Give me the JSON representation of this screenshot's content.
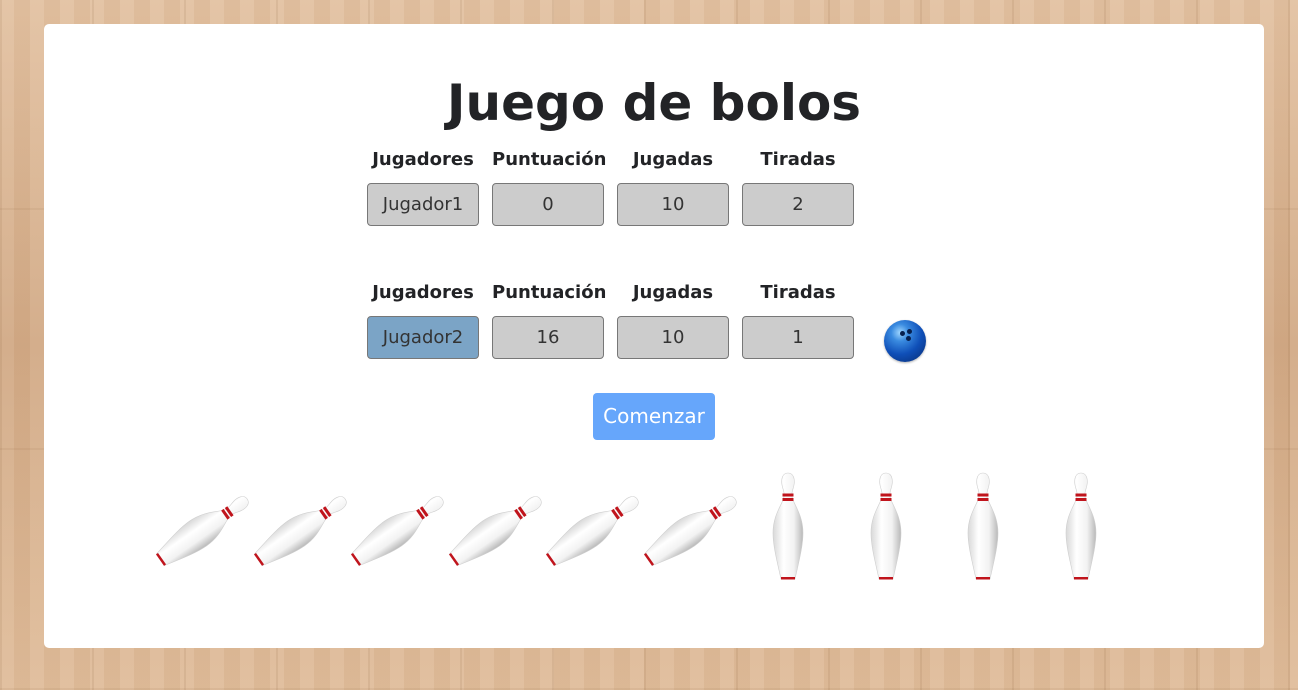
{
  "title": "Juego de bolos",
  "players": [
    {
      "headers": {
        "players": "Jugadores",
        "score": "Puntuación",
        "plays": "Jugadas",
        "throws": "Tiradas"
      },
      "name": "Jugador1",
      "score": "0",
      "plays": "10",
      "throws": "2",
      "active": false
    },
    {
      "headers": {
        "players": "Jugadores",
        "score": "Puntuación",
        "plays": "Jugadas",
        "throws": "Tiradas"
      },
      "name": "Jugador2",
      "score": "16",
      "plays": "10",
      "throws": "1",
      "active": true
    }
  ],
  "start_button": "Comenzar",
  "pins": {
    "total": 10,
    "states": [
      "fallen",
      "fallen",
      "fallen",
      "fallen",
      "fallen",
      "fallen",
      "standing",
      "standing",
      "standing",
      "standing"
    ]
  },
  "colors": {
    "active_field": "#7ba4c6",
    "inactive_field": "#cccccc",
    "button": "#66a6fb",
    "ball": "#0f4fb8",
    "pin_stripe": "#c0141c"
  },
  "icons": {
    "ball": "bowling-ball-icon",
    "pin": "bowling-pin-icon"
  }
}
